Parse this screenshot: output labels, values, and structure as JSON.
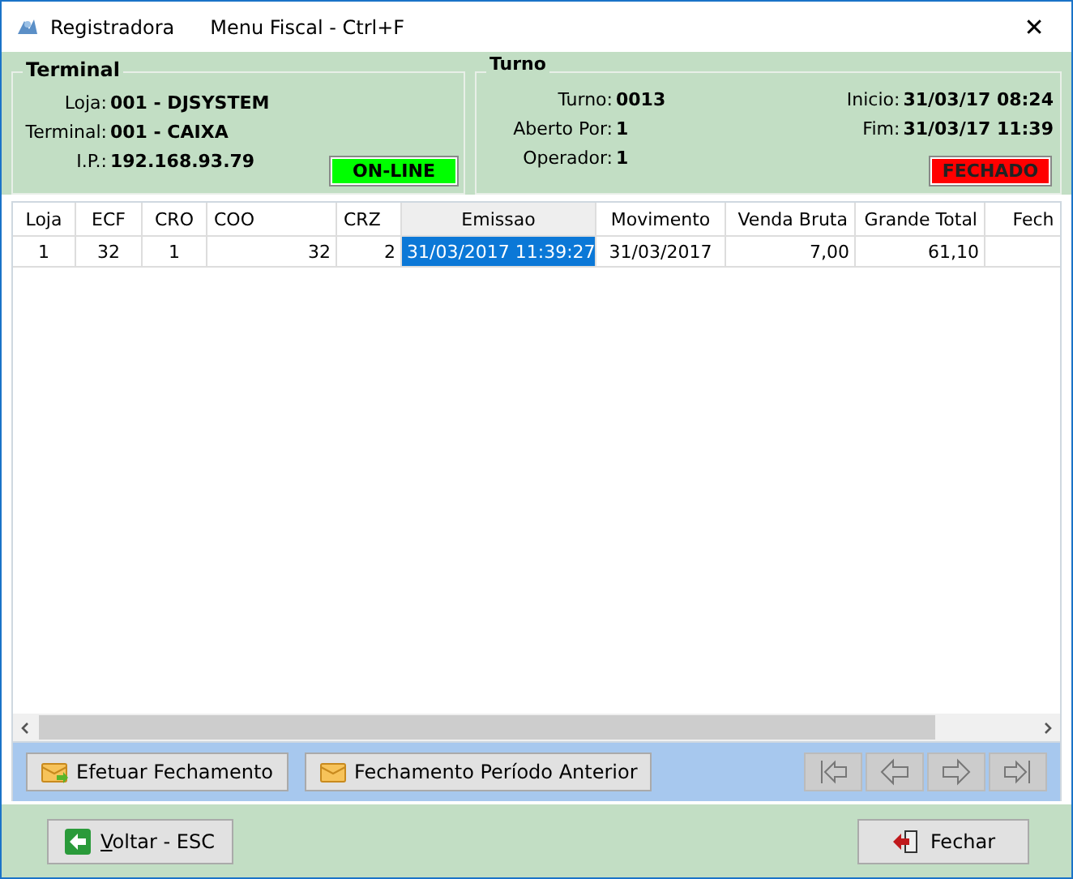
{
  "window": {
    "title": "Registradora",
    "menu": "Menu Fiscal - Ctrl+F",
    "close": "✕"
  },
  "terminal": {
    "title": "Terminal",
    "fields": [
      {
        "label": "Loja:",
        "value": "001 - DJSYSTEM"
      },
      {
        "label": "Terminal:",
        "value": "001 - CAIXA"
      },
      {
        "label": "I.P.:",
        "value": "192.168.93.79"
      }
    ],
    "status": {
      "text": "ON-LINE",
      "color": "#00ff00"
    }
  },
  "turno": {
    "title": "Turno",
    "left": [
      {
        "label": "Turno:",
        "value": "0013"
      },
      {
        "label": "Aberto Por:",
        "value": "1"
      },
      {
        "label": "Operador:",
        "value": "1"
      }
    ],
    "right": [
      {
        "label": "Inicio:",
        "value": "31/03/17 08:24"
      },
      {
        "label": "Fim:",
        "value": "31/03/17 11:39"
      }
    ],
    "status": {
      "text": "FECHADO",
      "color": "#ff0000"
    }
  },
  "table": {
    "columns": [
      "Loja",
      "ECF",
      "CRO",
      "COO",
      "CRZ",
      "Emissao",
      "Movimento",
      "Venda Bruta",
      "Grande Total",
      "Fech"
    ],
    "rows": [
      {
        "cells": [
          {
            "text": "1",
            "selected": false
          },
          {
            "text": "32",
            "selected": false
          },
          {
            "text": "1",
            "selected": false
          },
          {
            "text": "32",
            "selected": false
          },
          {
            "text": "2",
            "selected": false
          },
          {
            "text": "31/03/2017 11:39:27",
            "selected": true
          },
          {
            "text": "31/03/2017",
            "selected": false
          },
          {
            "text": "7,00",
            "selected": false
          },
          {
            "text": "61,10",
            "selected": false
          },
          {
            "text": "",
            "selected": false
          }
        ]
      }
    ]
  },
  "toolbar": {
    "buttons": [
      {
        "label": "Efetuar Fechamento",
        "kind": "close-period"
      },
      {
        "label": "Fechamento Período Anterior",
        "kind": "previous-period"
      }
    ],
    "nav": [
      {
        "kind": "first",
        "disabled": true
      },
      {
        "kind": "prev",
        "disabled": true
      },
      {
        "kind": "next",
        "disabled": true
      },
      {
        "kind": "last",
        "disabled": true
      }
    ]
  },
  "footer": {
    "back": "Voltar - ESC",
    "close": "Fechar"
  }
}
